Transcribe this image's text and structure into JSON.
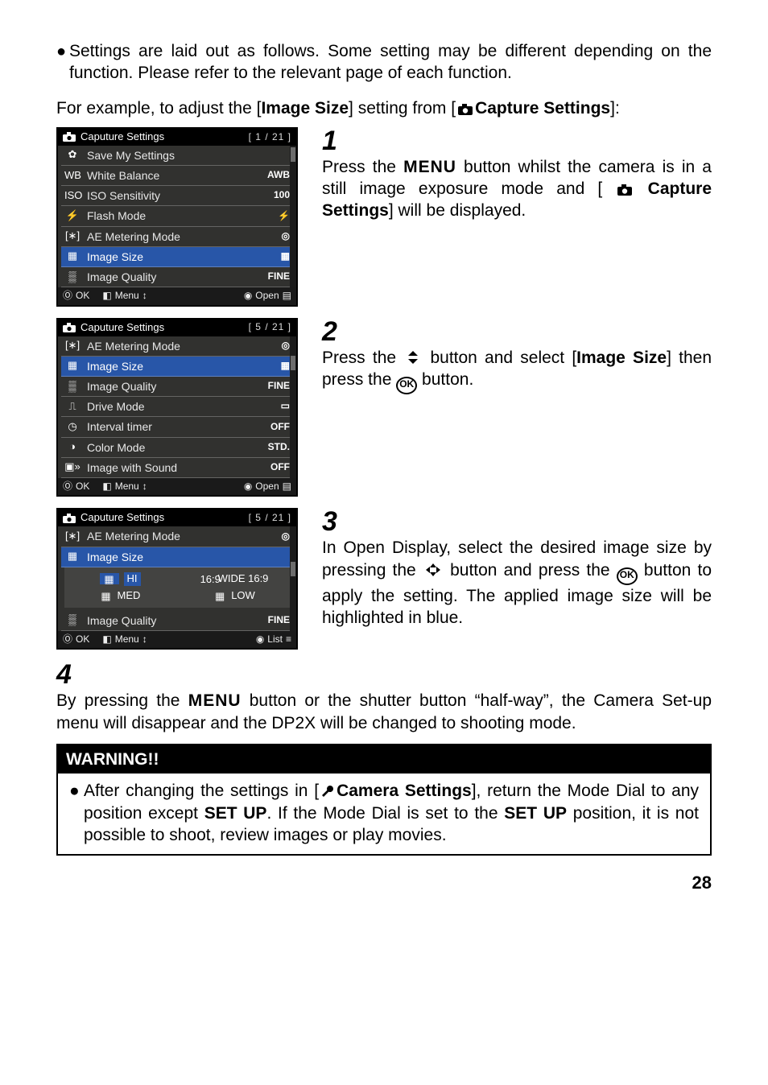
{
  "intro_bullet": "Settings are laid out as follows. Some setting may be different depending on the function. Please refer to the relevant page of each function.",
  "intro2_a": "For example, to adjust the [",
  "intro2_b": "Image Size",
  "intro2_c": "] setting from [",
  "intro2_d": "Capture Settings",
  "intro2_e": "]:",
  "screens": {
    "title": "Caputure Settings",
    "page1": "[  1  / 21 ]",
    "page5": "[  5  / 21 ]",
    "footer_ok": "OK",
    "footer_menu": "Menu",
    "footer_open": "Open",
    "footer_list": "List",
    "s1": [
      {
        "icon": "save",
        "label": "Save My Settings",
        "val": ""
      },
      {
        "icon": "wb",
        "label": "White Balance",
        "val": "AWB"
      },
      {
        "icon": "iso",
        "label": "ISO Sensitivity",
        "val": "100"
      },
      {
        "icon": "flash",
        "label": "Flash Mode",
        "val": "⚡"
      },
      {
        "icon": "ae",
        "label": "AE Metering Mode",
        "val": "◎"
      },
      {
        "icon": "grid",
        "label": "Image Size",
        "val": "▦",
        "hl": true
      },
      {
        "icon": "dots",
        "label": "Image Quality",
        "val": "FINE"
      }
    ],
    "s2": [
      {
        "icon": "ae",
        "label": "AE Metering Mode",
        "val": "◎"
      },
      {
        "icon": "grid",
        "label": "Image Size",
        "val": "▦",
        "hl": true
      },
      {
        "icon": "dots",
        "label": "Image Quality",
        "val": "FINE"
      },
      {
        "icon": "drive",
        "label": "Drive Mode",
        "val": "▭"
      },
      {
        "icon": "timer",
        "label": "Interval timer",
        "val": "OFF"
      },
      {
        "icon": "color",
        "label": "Color Mode",
        "val": "STD."
      },
      {
        "icon": "sound",
        "label": "Image with Sound",
        "val": "OFF"
      }
    ],
    "s3_top": [
      {
        "icon": "ae",
        "label": "AE Metering Mode",
        "val": "◎"
      },
      {
        "icon": "grid",
        "label": "Image Size",
        "val": "",
        "hl": true
      }
    ],
    "s3_opts": [
      {
        "label": "HI",
        "sel": true
      },
      {
        "label": "WIDE 16:9"
      },
      {
        "label": "MED"
      },
      {
        "label": "LOW"
      }
    ],
    "s3_bottom": {
      "icon": "dots",
      "label": "Image Quality",
      "val": "FINE"
    }
  },
  "steps": {
    "n1": "1",
    "n2": "2",
    "n3": "3",
    "n4": "4",
    "s1a": "Press the ",
    "s1menu": "MENU",
    "s1b": " button whilst the camera is in a still image exposure mode and [ ",
    "s1c": " Capture Settings",
    "s1d": "] will be displayed.",
    "s2a": "Press the ",
    "s2b": " button and select [",
    "s2bold": "Image Size",
    "s2c": "] then press the ",
    "s2d": "  button.",
    "s3a": "In Open Display, select the desired image size by pressing the ",
    "s3b": " button and press the ",
    "s3c": " button to apply the setting. The applied image size will be highlighted in blue.",
    "s4a": "By pressing the ",
    "s4b": " button or the shutter button “half-way”, the Camera Set-up menu will disappear and the DP2X will be changed to shooting mode."
  },
  "warning": {
    "title": "WARNING!!",
    "a": "After changing the settings in [",
    "b": "Camera Settings",
    "c": "], return the Mode Dial to any position except ",
    "d": "SET UP",
    "e": ". If the Mode Dial is set to the ",
    "f": "SET UP",
    "g": " position, it is not possible to shoot, review images or play movies."
  },
  "page_number": "28",
  "ok_text": "OK"
}
